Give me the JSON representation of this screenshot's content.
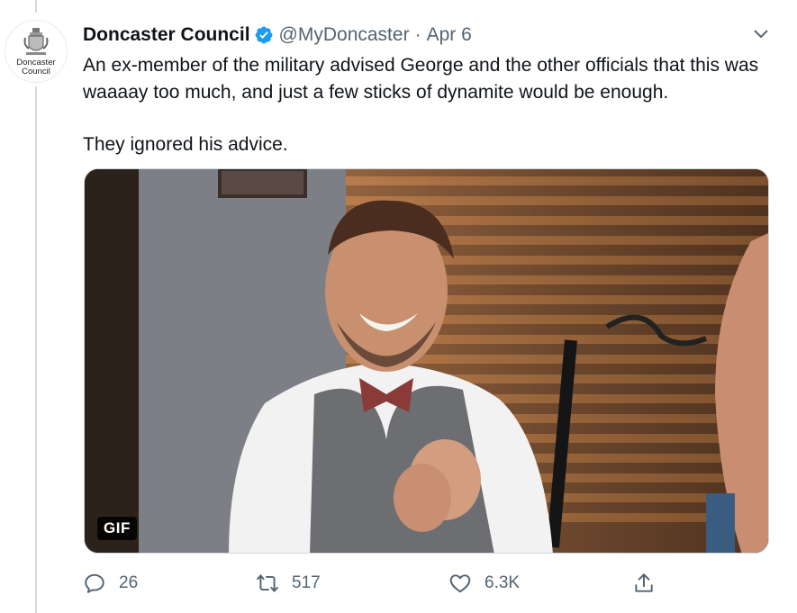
{
  "tweet": {
    "author_name": "Doncaster Council",
    "handle": "@MyDoncaster",
    "separator": "·",
    "date": "Apr 6",
    "verified": true,
    "avatar_text_line1": "Doncaster",
    "avatar_text_line2": "Council",
    "text_paragraph_1": "An ex-member of the military advised George and the other officials that this was waaaay too much, and just a few sticks of dynamite would be enough.",
    "text_paragraph_2": "They ignored his advice.",
    "media": {
      "badge": "GIF"
    },
    "actions": {
      "reply_count": "26",
      "retweet_count": "517",
      "like_count": "6.3K"
    }
  },
  "colors": {
    "verified": "#1d9bf0",
    "secondary_text": "#536471",
    "thread_line": "#cfd9de"
  },
  "icons": [
    "verified-badge-icon",
    "chevron-down-icon",
    "reply-icon",
    "retweet-icon",
    "like-icon",
    "share-icon"
  ]
}
